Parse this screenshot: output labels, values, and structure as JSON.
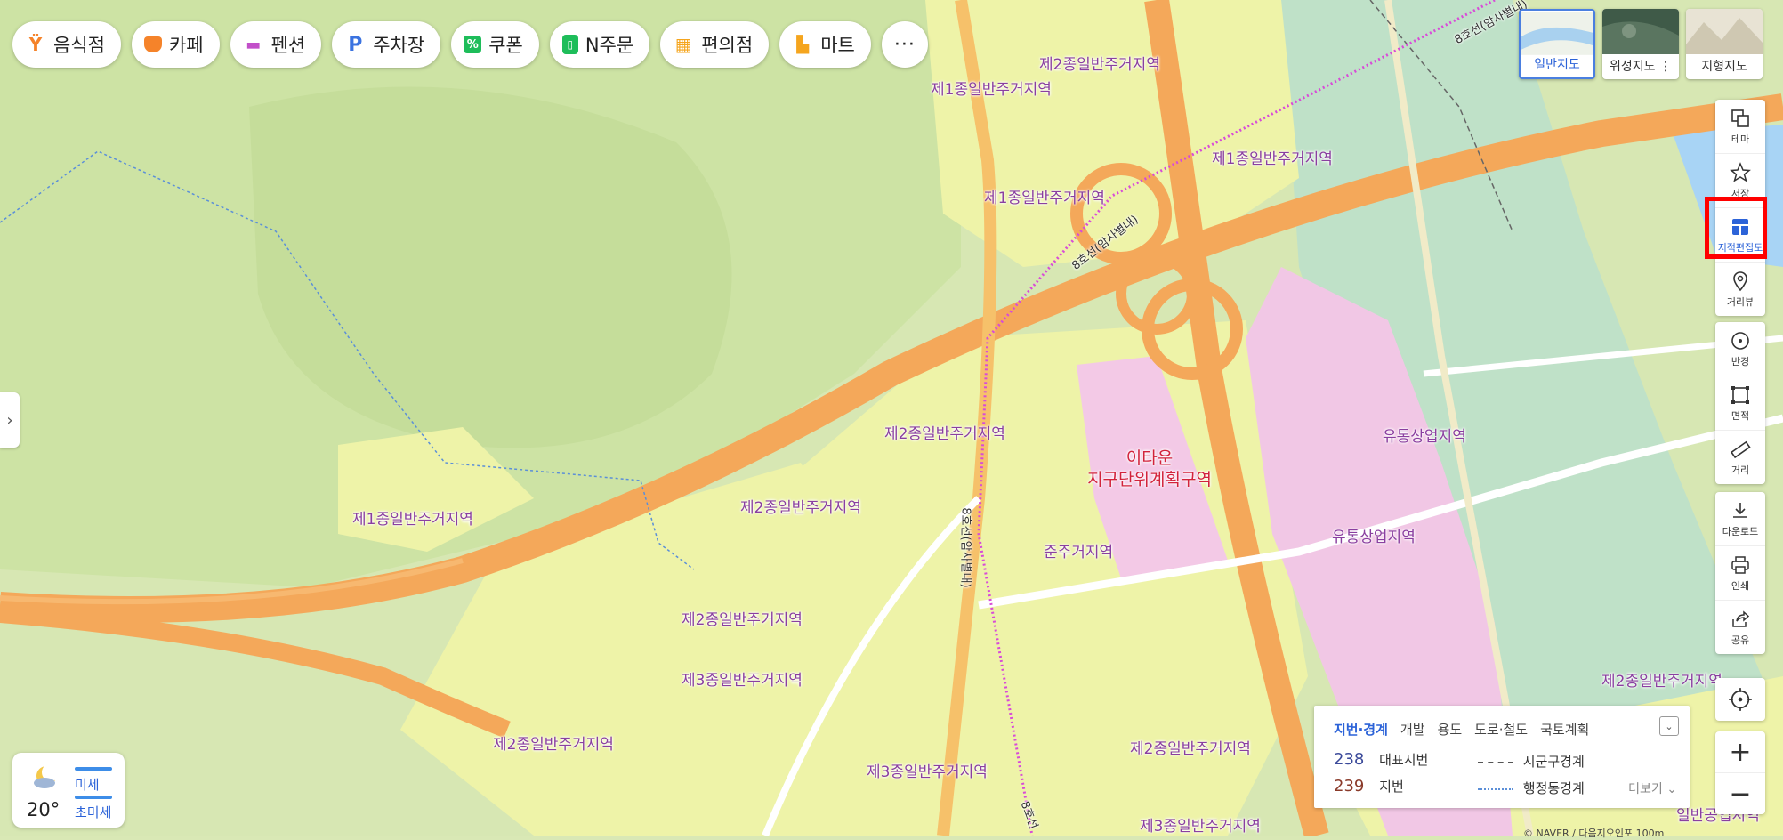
{
  "categories": [
    {
      "label": "음식점",
      "icon": "restaurant-icon",
      "color": "#f5832a"
    },
    {
      "label": "카페",
      "icon": "cafe-icon",
      "color": "#f5832a"
    },
    {
      "label": "펜션",
      "icon": "bed-icon",
      "color": "#c24fc9"
    },
    {
      "label": "주차장",
      "icon": "parking-icon",
      "color": "#3b73e0"
    },
    {
      "label": "쿠폰",
      "icon": "coupon-icon",
      "color": "#1ebd5a"
    },
    {
      "label": "N주문",
      "icon": "order-icon",
      "color": "#1ebd5a"
    },
    {
      "label": "편의점",
      "icon": "store-icon",
      "color": "#f5a51e"
    },
    {
      "label": "마트",
      "icon": "cart-icon",
      "color": "#f5a51e"
    },
    {
      "label": "···",
      "icon": "more-icon"
    }
  ],
  "map_types": [
    {
      "label": "일반지도",
      "active": true
    },
    {
      "label": "위성지도 ⋮",
      "active": false
    },
    {
      "label": "지형지도",
      "active": false
    }
  ],
  "tools": {
    "group1": [
      {
        "label": "테마",
        "icon": "layers-icon"
      },
      {
        "label": "저장",
        "icon": "star-icon"
      },
      {
        "label": "지적편집도",
        "icon": "cadastral-icon",
        "active": true
      },
      {
        "label": "거리뷰",
        "icon": "street-view-icon"
      }
    ],
    "group2": [
      {
        "label": "반경",
        "icon": "radius-icon"
      },
      {
        "label": "면적",
        "icon": "area-icon"
      },
      {
        "label": "거리",
        "icon": "ruler-icon"
      }
    ],
    "group3": [
      {
        "label": "다운로드",
        "icon": "download-icon"
      },
      {
        "label": "인쇄",
        "icon": "print-icon"
      },
      {
        "label": "공유",
        "icon": "share-icon"
      }
    ]
  },
  "zoom": {
    "in": "+",
    "out": "−"
  },
  "legend": {
    "tabs": [
      "지번·경계",
      "개발",
      "용도",
      "도로·철도",
      "국토계획"
    ],
    "rep_num": "238",
    "rep_label": "대표지번",
    "lot_num": "239",
    "lot_label": "지번",
    "boundary1": "시군구경계",
    "boundary2": "행정동경계",
    "more": "더보기 ⌄"
  },
  "weather": {
    "temp": "20°",
    "fine_dust": "미세",
    "ultra_fine_dust": "초미세"
  },
  "map_labels": {
    "l1": "제2종일반주거지역",
    "l2": "제1종일반주거지역",
    "l3": "제1종일반주거지역",
    "l4": "제1종일반주거지역",
    "l5": "제2종일반주거지역",
    "l6": "제1종일반주거지역",
    "l7": "제2종일반주거지역",
    "l8": "유통상업지역",
    "l9": "유통상업지역",
    "l10": "준주거지역",
    "l11": "제2종일반주거지역",
    "l12": "제3종일반주거지역",
    "l13": "제2종일반주거지역",
    "l14": "제3종일반주거지역",
    "l15": "제2종일반주거지역",
    "l16": "제3종일반주거지역",
    "l17": "제2종일반주거지역",
    "l18": "일반공업지역",
    "red1": "이타운",
    "red2": "지구단위계획구역",
    "rail1": "8호선(암사별내)",
    "rail2": "8호선(암사별내)",
    "rail3": "8호선(암사별내)",
    "rail4": "8호선"
  },
  "copyright": "© NAVER / 다음지오인포  100m",
  "colors": {
    "accent": "#2c63d8",
    "highlight": "#ff0000",
    "road": "#f4a85a",
    "residential": "#eef3a8",
    "commercial": "#f3c9e6",
    "green": "#cfe4a6"
  }
}
